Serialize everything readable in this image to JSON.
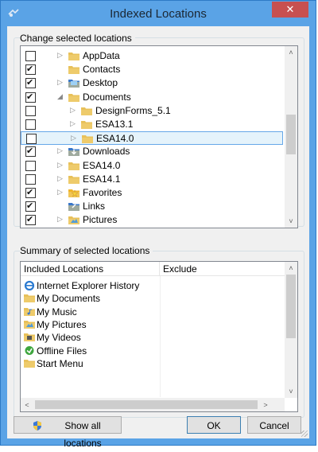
{
  "window": {
    "title": "Indexed Locations",
    "close_glyph": "✕"
  },
  "change_group": {
    "label": "Change selected locations"
  },
  "tree": [
    {
      "label": "AppData",
      "checked": false,
      "indent": 0,
      "expander": true,
      "icon": "folder-icon"
    },
    {
      "label": "Contacts",
      "checked": true,
      "indent": 0,
      "expander": false,
      "icon": "contacts-folder-icon"
    },
    {
      "label": "Desktop",
      "checked": true,
      "indent": 0,
      "expander": true,
      "icon": "desktop-folder-icon"
    },
    {
      "label": "Documents",
      "checked": true,
      "indent": 0,
      "expander": "open",
      "icon": "documents-folder-icon"
    },
    {
      "label": "DesignForms_5.1",
      "checked": false,
      "indent": 1,
      "expander": true,
      "icon": "folder-icon"
    },
    {
      "label": "ESA13.1",
      "checked": false,
      "indent": 1,
      "expander": true,
      "icon": "folder-icon"
    },
    {
      "label": "ESA14.0",
      "checked": false,
      "indent": 1,
      "expander": true,
      "icon": "folder-icon",
      "selected": true
    },
    {
      "label": "Downloads",
      "checked": true,
      "indent": 0,
      "expander": true,
      "icon": "downloads-folder-icon"
    },
    {
      "label": "ESA14.0",
      "checked": false,
      "indent": 0,
      "expander": true,
      "icon": "folder-icon"
    },
    {
      "label": "ESA14.1",
      "checked": false,
      "indent": 0,
      "expander": true,
      "icon": "folder-icon"
    },
    {
      "label": "Favorites",
      "checked": true,
      "indent": 0,
      "expander": true,
      "icon": "favorites-folder-icon"
    },
    {
      "label": "Links",
      "checked": true,
      "indent": 0,
      "expander": false,
      "icon": "links-folder-icon"
    },
    {
      "label": "Pictures",
      "checked": true,
      "indent": 0,
      "expander": true,
      "icon": "pictures-folder-icon"
    }
  ],
  "summary_group": {
    "label": "Summary of selected locations"
  },
  "summary": {
    "col_included": "Included Locations",
    "col_exclude": "Exclude",
    "items": [
      {
        "label": "Internet Explorer History",
        "icon": "internet-explorer-icon"
      },
      {
        "label": "My Documents",
        "icon": "documents-folder-icon"
      },
      {
        "label": "My Music",
        "icon": "music-folder-icon"
      },
      {
        "label": "My Pictures",
        "icon": "pictures-folder-icon"
      },
      {
        "label": "My Videos",
        "icon": "videos-folder-icon"
      },
      {
        "label": "Offline Files",
        "icon": "offline-files-icon"
      },
      {
        "label": "Start Menu",
        "icon": "folder-icon"
      }
    ]
  },
  "buttons": {
    "show_all": "Show all locations",
    "ok": "OK",
    "cancel": "Cancel"
  },
  "scroll_glyphs": {
    "up": "˄",
    "down": "˅",
    "left": "<",
    "right": ">"
  }
}
